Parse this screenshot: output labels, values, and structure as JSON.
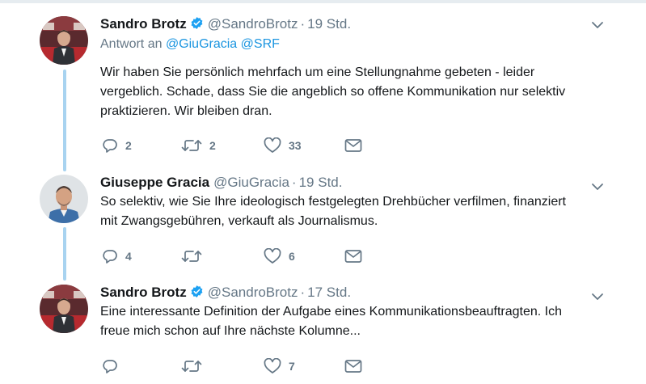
{
  "tweets": [
    {
      "name": "Sandro Brotz",
      "verified": true,
      "handle": "@SandroBrotz",
      "separator": "·",
      "time": "19 Std.",
      "reply_prefix": "Antwort an",
      "reply_handles": [
        "@GiuGracia",
        "@SRF"
      ],
      "text_lines": [
        "Wir haben Sie persönlich mehrfach um eine Stellungnahme gebeten - leider",
        "vergeblich. Schade, dass Sie die angeblich so offene Kommunikation nur selektiv",
        "praktizieren. Wir bleiben dran."
      ],
      "replies": "2",
      "retweets": "2",
      "likes": "33"
    },
    {
      "name": "Giuseppe Gracia",
      "verified": false,
      "handle": "@GiuGracia",
      "separator": "·",
      "time": "19 Std.",
      "text_lines": [
        "So selektiv, wie Sie Ihre ideologisch festgelegten Drehbücher verfilmen, finanziert",
        "mit Zwangsgebühren, verkauft als Journalismus."
      ],
      "replies": "4",
      "retweets": "",
      "likes": "6"
    },
    {
      "name": "Sandro Brotz",
      "verified": true,
      "handle": "@SandroBrotz",
      "separator": "·",
      "time": "17 Std.",
      "text_lines": [
        "Eine interessante Definition der Aufgabe eines Kommunikationsbeauftragten. Ich",
        "freue mich schon auf Ihre nächste Kolumne..."
      ],
      "replies": "",
      "retweets": "",
      "likes": "7"
    }
  ],
  "icons": {
    "reply": "reply-icon",
    "retweet": "retweet-icon",
    "like": "heart-icon",
    "dm": "envelope-icon",
    "more": "chevron-down-icon",
    "verified": "verified-badge-icon"
  },
  "colors": {
    "link": "#1b95e0",
    "muted": "#657786",
    "thread_line": "#a8d3f0",
    "verified": "#1da1f2"
  }
}
